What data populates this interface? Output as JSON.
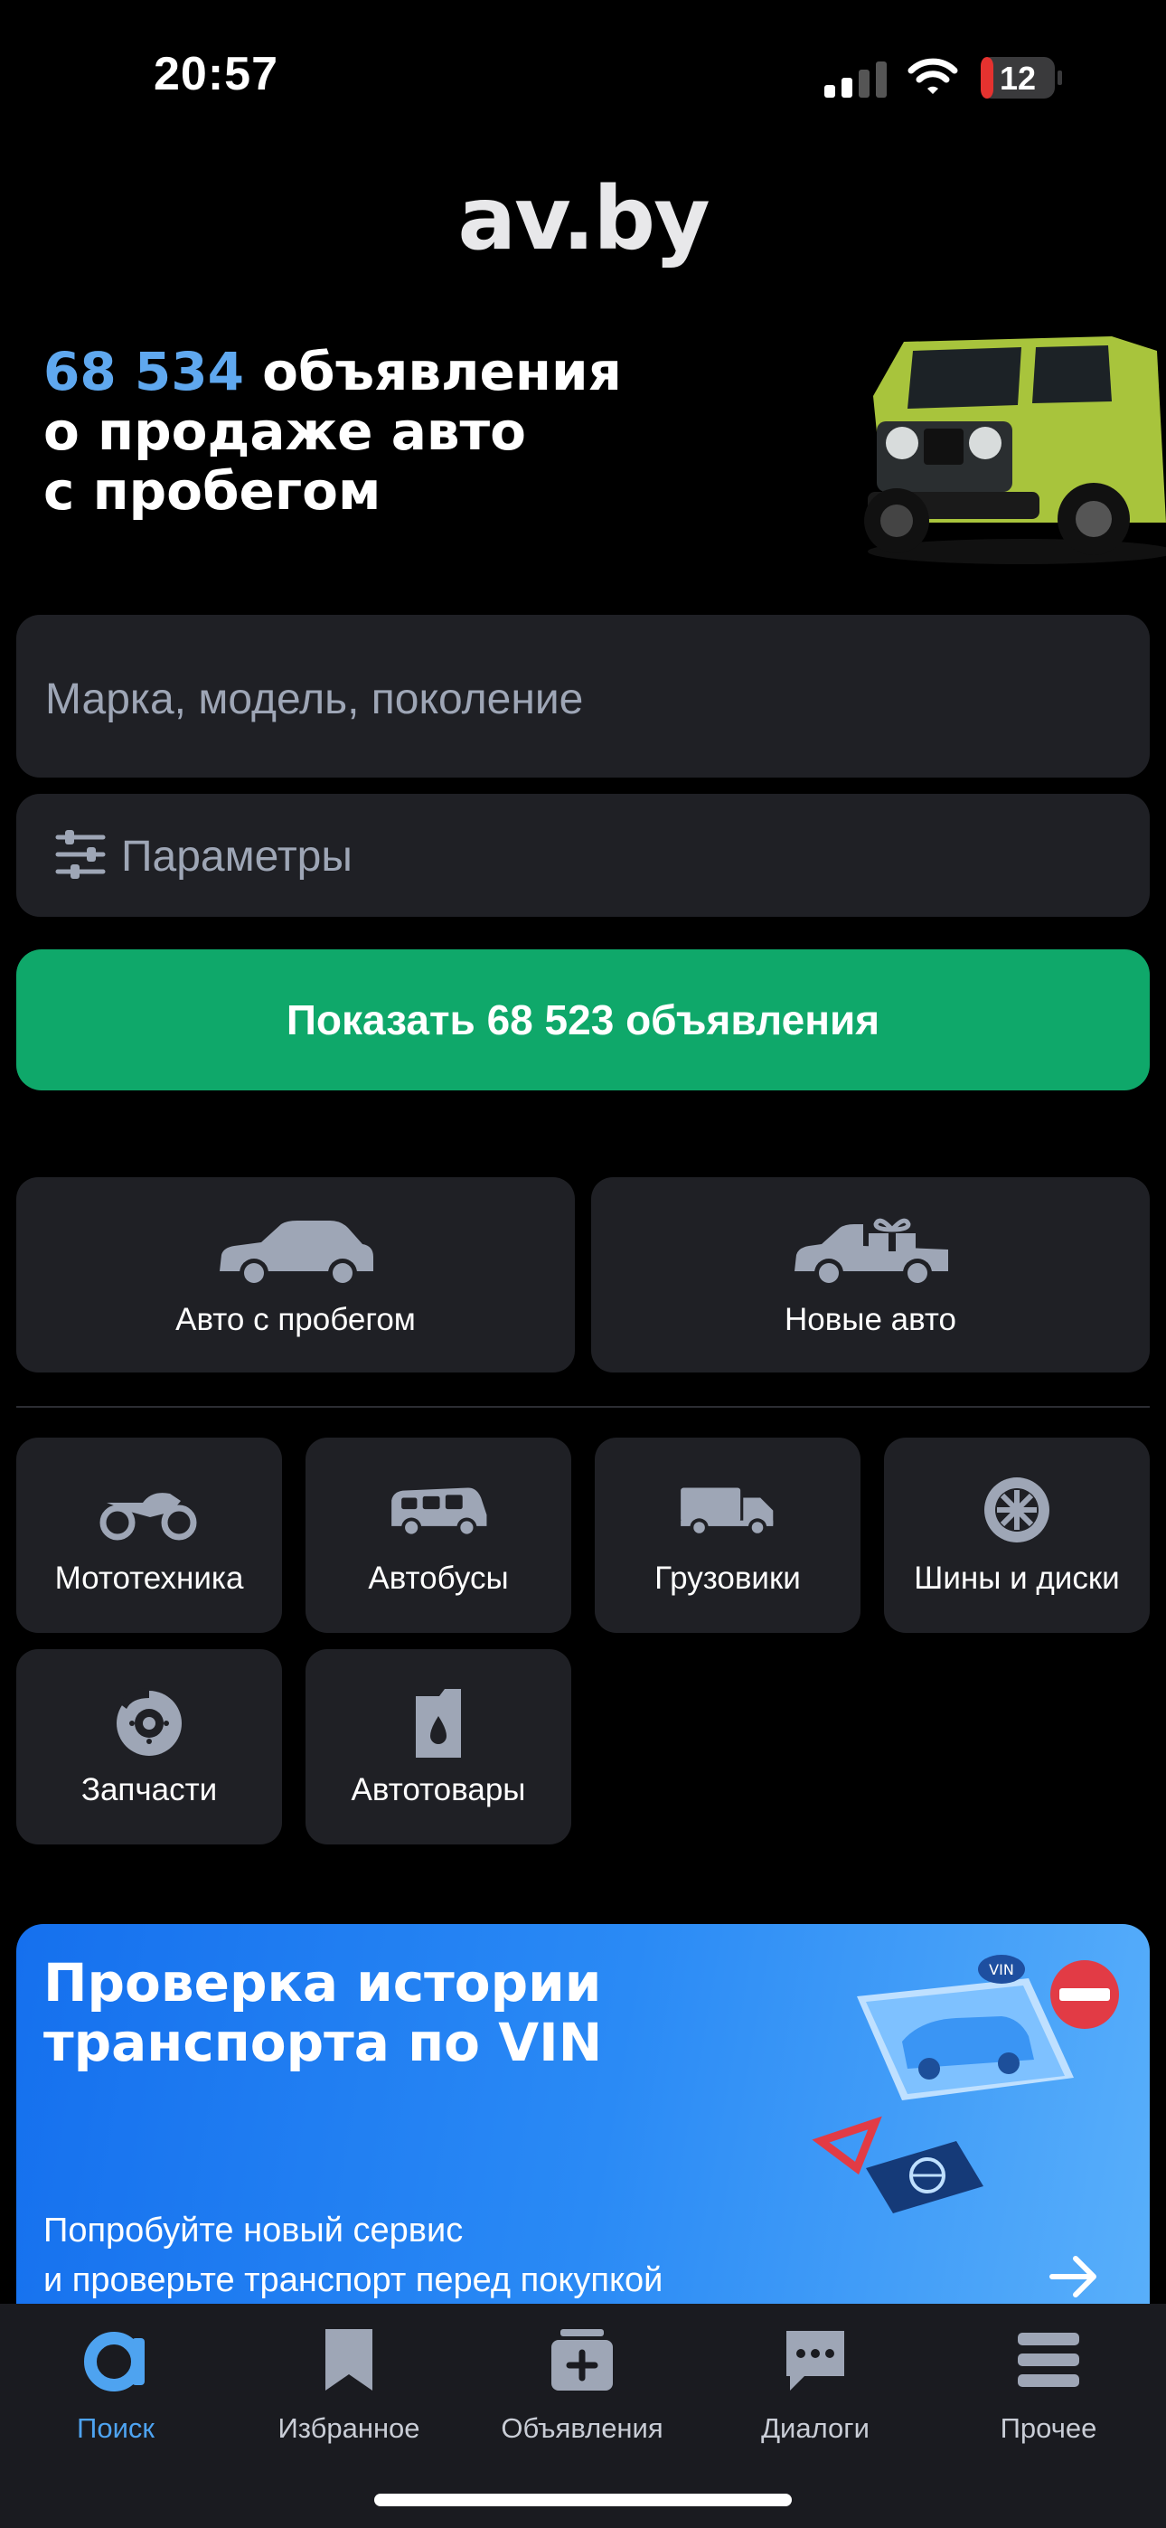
{
  "status_bar": {
    "time": "20:57",
    "battery_level": "12",
    "icons": [
      "signal-icon",
      "wifi-icon",
      "battery-icon"
    ]
  },
  "app": {
    "logo": "av.by"
  },
  "hero": {
    "count": "68 534",
    "line1_rest": " объявления",
    "line2": "о продаже авто",
    "line3": "с пробегом"
  },
  "search": {
    "placeholder": "Марка, модель, поколение",
    "params_label": "Параметры",
    "show_button": "Показать 68 523 объявления"
  },
  "categories_main": [
    {
      "label": "Авто с пробегом",
      "icon": "used-car-icon"
    },
    {
      "label": "Новые авто",
      "icon": "new-car-gift-icon"
    }
  ],
  "categories": [
    {
      "label": "Мототехника",
      "icon": "motorcycle-icon"
    },
    {
      "label": "Автобусы",
      "icon": "bus-icon"
    },
    {
      "label": "Грузовики",
      "icon": "truck-icon"
    },
    {
      "label": "Шины и диски",
      "icon": "wheel-icon"
    },
    {
      "label": "Запчасти",
      "icon": "brake-disc-icon"
    },
    {
      "label": "Автотовары",
      "icon": "oil-canister-icon"
    }
  ],
  "vin_banner": {
    "title_line1": "Проверка истории",
    "title_line2": "транспорта по VIN",
    "subtitle_line1": "Попробуйте новый сервис",
    "subtitle_line2": "и проверьте транспорт перед покупкой",
    "art_badge": "VIN"
  },
  "tabs": [
    {
      "label": "Поиск",
      "icon": "search-a-icon",
      "active": true
    },
    {
      "label": "Избранное",
      "icon": "bookmark-icon",
      "active": false
    },
    {
      "label": "Объявления",
      "icon": "add-listing-icon",
      "active": false
    },
    {
      "label": "Диалоги",
      "icon": "chat-icon",
      "active": false
    },
    {
      "label": "Прочее",
      "icon": "menu-icon",
      "active": false
    }
  ],
  "colors": {
    "accent_blue": "#4ea3f0",
    "hero_count": "#5fa8ef",
    "green_button": "#0fa86a",
    "tile_bg": "#1f2025",
    "icon_gray": "#9ea6b6",
    "battery_red": "#e5322f"
  }
}
